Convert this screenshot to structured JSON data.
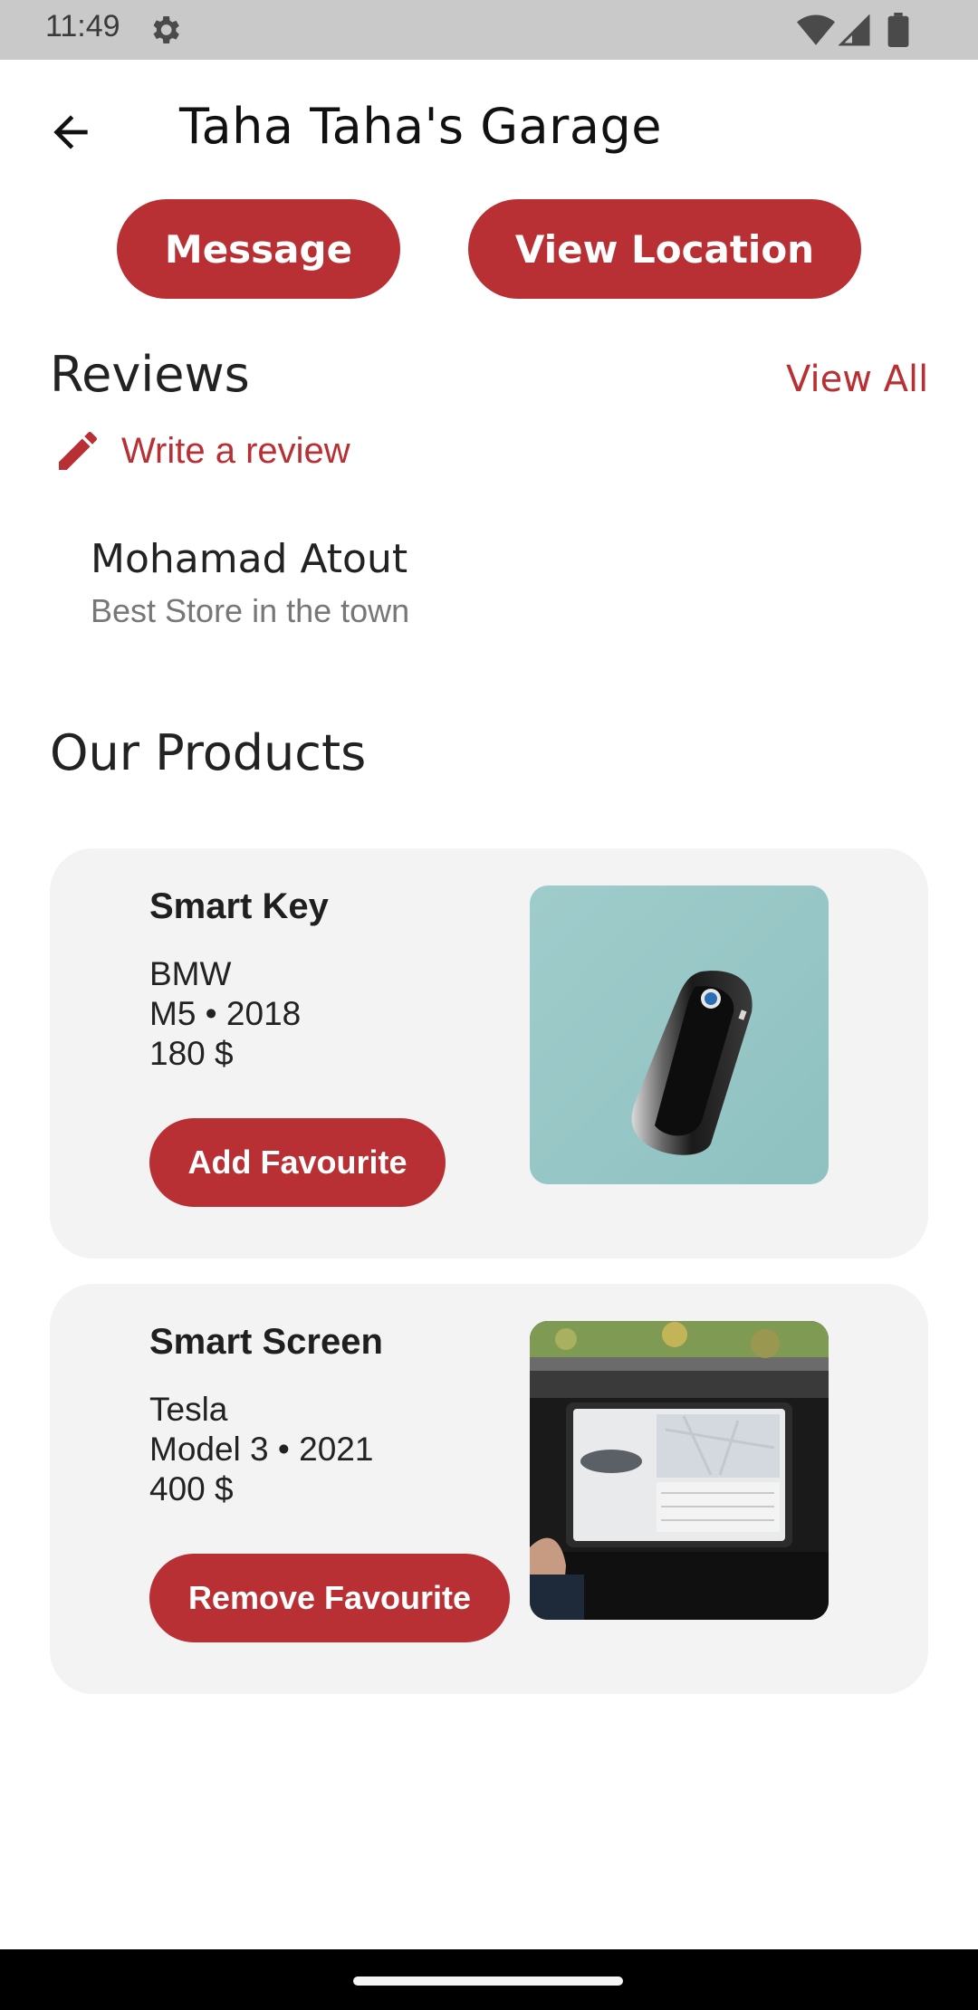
{
  "status_bar": {
    "time": "11:49",
    "icons": [
      "gear-icon",
      "wifi-icon",
      "signal-icon",
      "battery-icon"
    ]
  },
  "app_bar": {
    "back_icon": "arrow-left-icon",
    "title": "Taha Taha's Garage"
  },
  "actions": {
    "message_label": "Message",
    "location_label": "View Location"
  },
  "reviews": {
    "title": "Reviews",
    "view_all_label": "View All",
    "write_review_label": "Write a review",
    "items": [
      {
        "reviewer": "Mohamad Atout",
        "text": "Best Store in the town"
      }
    ]
  },
  "products": {
    "title": "Our Products",
    "items": [
      {
        "name": "Smart Key",
        "brand": "BMW",
        "model_year": "M5 • 2018",
        "price": "180 $",
        "button_label": "Add Favourite",
        "image_icon": "car-key-photo"
      },
      {
        "name": "Smart Screen",
        "brand": "Tesla",
        "model_year": "Model 3 • 2021",
        "price": "400 $",
        "button_label": "Remove Favourite",
        "image_icon": "car-screen-photo"
      }
    ]
  },
  "colors": {
    "accent": "#b83033",
    "card_background": "#f4f3f4",
    "status_bar": "#c9c9c9"
  }
}
